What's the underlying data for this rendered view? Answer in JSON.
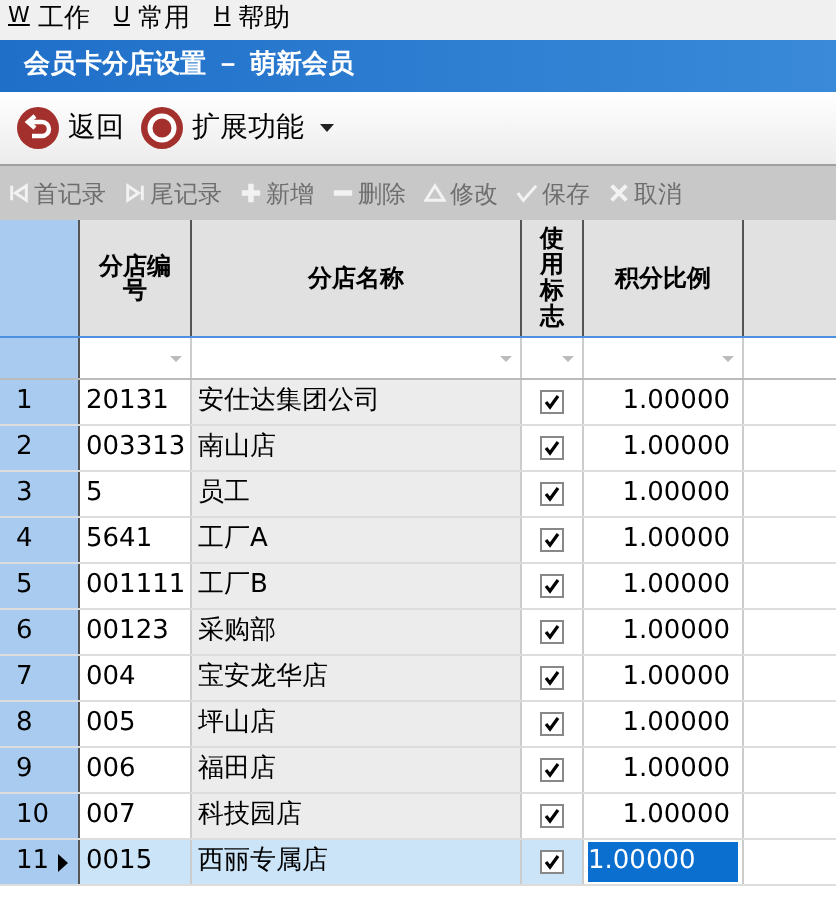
{
  "menu": [
    {
      "key": "W",
      "label": "工作"
    },
    {
      "key": "U",
      "label": "常用"
    },
    {
      "key": "H",
      "label": "帮助"
    }
  ],
  "window": {
    "title": "会员卡分店设置 － 萌新会员"
  },
  "toolbar": [
    {
      "kind": "back",
      "label": "返回"
    },
    {
      "kind": "extend",
      "label": "扩展功能",
      "dropdown": true
    }
  ],
  "nav": [
    {
      "kind": "first",
      "label": "首记录",
      "disabled": true
    },
    {
      "kind": "last",
      "label": "尾记录",
      "disabled": true
    },
    {
      "kind": "add",
      "label": "新增",
      "disabled": true
    },
    {
      "kind": "delete",
      "label": "删除",
      "disabled": true
    },
    {
      "kind": "edit",
      "label": "修改",
      "disabled": true
    },
    {
      "kind": "save",
      "label": "保存",
      "disabled": true
    },
    {
      "kind": "cancel",
      "label": "取消",
      "disabled": true
    }
  ],
  "table": {
    "columns": [
      "分店编号",
      "分店名称",
      "使用标志",
      "积分比例"
    ],
    "rows": [
      {
        "index": "1",
        "code": "20131",
        "name": "安仕达集团公司",
        "checked": true,
        "ratio": "1.00000",
        "selected": false
      },
      {
        "index": "2",
        "code": "003313",
        "name": "南山店",
        "checked": true,
        "ratio": "1.00000",
        "selected": false
      },
      {
        "index": "3",
        "code": "5",
        "name": "员工",
        "checked": true,
        "ratio": "1.00000",
        "selected": false
      },
      {
        "index": "4",
        "code": "5641",
        "name": "工厂A",
        "checked": true,
        "ratio": "1.00000",
        "selected": false
      },
      {
        "index": "5",
        "code": "001111",
        "name": "工厂B",
        "checked": true,
        "ratio": "1.00000",
        "selected": false
      },
      {
        "index": "6",
        "code": "00123",
        "name": "采购部",
        "checked": true,
        "ratio": "1.00000",
        "selected": false
      },
      {
        "index": "7",
        "code": "004",
        "name": "宝安龙华店",
        "checked": true,
        "ratio": "1.00000",
        "selected": false
      },
      {
        "index": "8",
        "code": "005",
        "name": "坪山店",
        "checked": true,
        "ratio": "1.00000",
        "selected": false
      },
      {
        "index": "9",
        "code": "006",
        "name": "福田店",
        "checked": true,
        "ratio": "1.00000",
        "selected": false
      },
      {
        "index": "10",
        "code": "007",
        "name": "科技园店",
        "checked": true,
        "ratio": "1.00000",
        "selected": false
      },
      {
        "index": "11",
        "code": "0015",
        "name": "西丽专属店",
        "checked": true,
        "ratio": "1.00000",
        "selected": true
      }
    ]
  }
}
